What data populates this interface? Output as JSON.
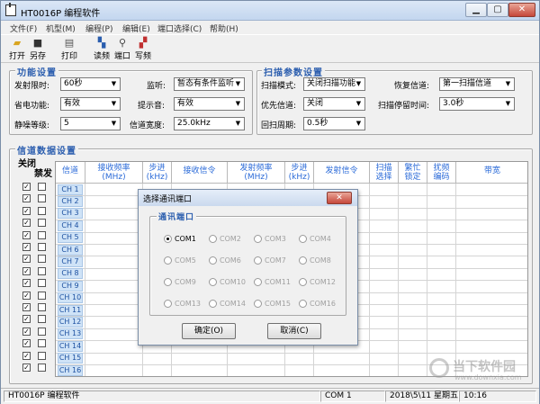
{
  "window": {
    "title": "HT0016P 编程软件"
  },
  "menu": [
    "文件(F)",
    "机型(M)",
    "编程(P)",
    "编辑(E)",
    "端口选择(C)",
    "帮助(H)"
  ],
  "toolbar": {
    "open": "打开",
    "saveas": "另存",
    "print": "打印",
    "read": "读频",
    "port": "端口",
    "write": "写频"
  },
  "function": {
    "title": "功能设置",
    "tot_label": "发射限时:",
    "tot_value": "60秒",
    "monitor_label": "监听:",
    "monitor_value": "暂态有条件监听",
    "save_label": "省电功能:",
    "save_value": "有效",
    "beep_label": "提示音:",
    "beep_value": "有效",
    "squelch_label": "静噪等级:",
    "squelch_value": "5",
    "bandwidth_label": "信道宽度:",
    "bandwidth_value": "25.0kHz"
  },
  "scan": {
    "title": "扫描参数设置",
    "mode_label": "扫描模式:",
    "mode_value": "关闭扫描功能",
    "resume_label": "恢复信道:",
    "resume_value": "第一扫描信道",
    "priority_label": "优先信道:",
    "priority_value": "关闭",
    "stop_label": "扫描停留时间:",
    "stop_value": "3.0秒",
    "period_label": "回扫周期:",
    "period_value": "0.5秒"
  },
  "channel": {
    "title": "信道数据设置",
    "close_label": "关闭",
    "ban_label": "禁发",
    "headers": [
      "信道",
      "接收频率\n(MHz)",
      "步进\n(kHz)",
      "接收信令",
      "发射频率\n(MHz)",
      "步进\n(kHz)",
      "发射信令",
      "扫描\n选择",
      "繁忙\n锁定",
      "扰频\n编码",
      "带宽"
    ],
    "rows": [
      "CH 1",
      "CH 2",
      "CH 3",
      "CH 4",
      "CH 5",
      "CH 6",
      "CH 7",
      "CH 8",
      "CH 9",
      "CH 10",
      "CH 11",
      "CH 12",
      "CH 13",
      "CH 14",
      "CH 15",
      "CH 16"
    ]
  },
  "dialog": {
    "title": "选择通讯端口",
    "group": "通讯端口",
    "ports": [
      "COM1",
      "COM2",
      "COM3",
      "COM4",
      "COM5",
      "COM6",
      "COM7",
      "COM8",
      "COM9",
      "COM10",
      "COM11",
      "COM12",
      "COM13",
      "COM14",
      "COM15",
      "COM16"
    ],
    "ok": "确定(O)",
    "cancel": "取消(C)"
  },
  "status": {
    "app": "HT0016P 编程软件",
    "port": "COM 1",
    "date": "2018\\5\\11 星期五",
    "time": "10:16"
  },
  "watermark": {
    "name": "当下软件园",
    "url": "www.downxia.com"
  }
}
